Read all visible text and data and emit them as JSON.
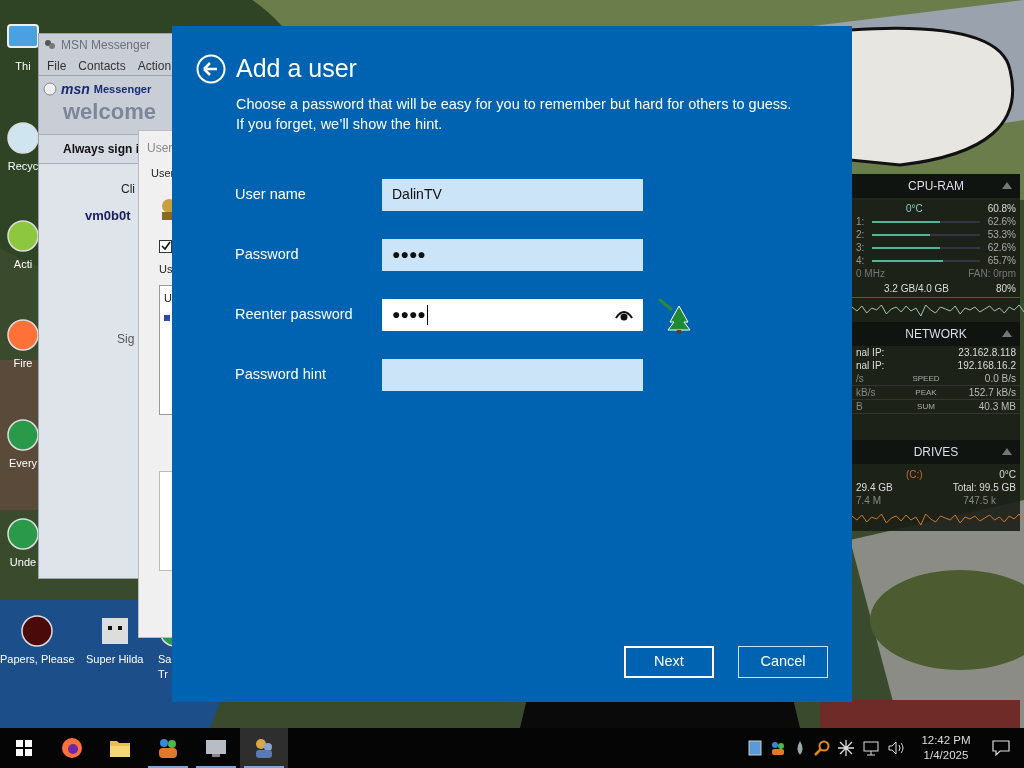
{
  "desktop_icons": [
    {
      "kind": "monitor",
      "label": "Thi"
    },
    {
      "kind": "recycle",
      "label": "Recyc"
    },
    {
      "kind": "app",
      "label": "Acti"
    },
    {
      "kind": "firefox",
      "label": "Fire"
    },
    {
      "kind": "game",
      "label": "Every"
    },
    {
      "kind": "game",
      "label": "Unde"
    },
    {
      "kind": "orb",
      "label": "Papers, Please"
    },
    {
      "kind": "pixel",
      "label": "Super Hilda"
    },
    {
      "kind": "game",
      "label": "Sa",
      "label_2": "Tr"
    }
  ],
  "msn_window": {
    "title": "MSN Messenger",
    "menu": [
      "File",
      "Contacts",
      "Action"
    ],
    "brand": "msn",
    "product": "Messenger",
    "welcome": "welcome",
    "sign_in": "Always sign i",
    "prompt": "Cli",
    "account": "vm0b0t",
    "link": "Sig"
  },
  "accounts_window": {
    "title": "User",
    "heading": "User",
    "option_checked": true,
    "list_label": "Us",
    "list_item": "U"
  },
  "gadget": {
    "cpu": {
      "title": "CPU-RAM",
      "temp": "0°C",
      "usage": "60.8%",
      "cores": [
        {
          "label": "1:",
          "value": "62.6%",
          "level": 0.626
        },
        {
          "label": "2:",
          "value": "53.3%",
          "level": 0.533
        },
        {
          "label": "3:",
          "value": "62.6%",
          "level": 0.626
        },
        {
          "label": "4:",
          "value": "65.7%",
          "level": 0.657
        }
      ],
      "clock": "0 MHz",
      "fan": "FAN: 0rpm",
      "ram": "3.2 GB/4.0 GB",
      "ram_usage": "80%"
    },
    "network": {
      "title": "NETWORK",
      "addresses": [
        {
          "label": "nal IP:",
          "value": "23.162.8.118"
        },
        {
          "label": "nal IP:",
          "value": "192.168.16.2"
        }
      ],
      "stats": [
        {
          "left": "/s",
          "name": "SPEED",
          "value": "0.0 B/s"
        },
        {
          "left": "kB/s",
          "name": "PEAK",
          "value": "152.7 kB/s"
        },
        {
          "left": "B",
          "name": "SUM",
          "value": "40.3 MB"
        }
      ]
    },
    "drives": {
      "title": "DRIVES",
      "drive": "(C:)",
      "temp": "0°C",
      "free": "29.4 GB",
      "total": "Total: 99.5 GB",
      "read": "7.4 M",
      "write": "747.5 k"
    }
  },
  "dialog": {
    "title": "Add a user",
    "description": "Choose a password that will be easy for you to remember but hard for others to guess. If you forget, we’ll show the hint.",
    "fields": [
      {
        "label": "User name",
        "value": "DalinTV",
        "focused": false,
        "reveal_button": false
      },
      {
        "label": "Password",
        "value": "●●●●",
        "focused": false,
        "reveal_button": false
      },
      {
        "label": "Reenter password",
        "value": "●●●●",
        "focused": true,
        "reveal_button": true
      },
      {
        "label": "Password hint",
        "focused": false,
        "reveal_button": false
      }
    ],
    "buttons": [
      {
        "label": "Next",
        "focused": true
      },
      {
        "label": "Cancel",
        "focused": false
      }
    ]
  },
  "taskbar": {
    "apps": [
      {
        "kind": "firefox",
        "running": false,
        "selected": false
      },
      {
        "kind": "folder",
        "running": false,
        "selected": false
      },
      {
        "kind": "messenger",
        "running": true,
        "selected": false
      },
      {
        "kind": "monitor",
        "running": true,
        "selected": false
      },
      {
        "kind": "users",
        "running": true,
        "selected": true
      }
    ],
    "time": "12:42 PM",
    "date": "1/4/2025"
  }
}
